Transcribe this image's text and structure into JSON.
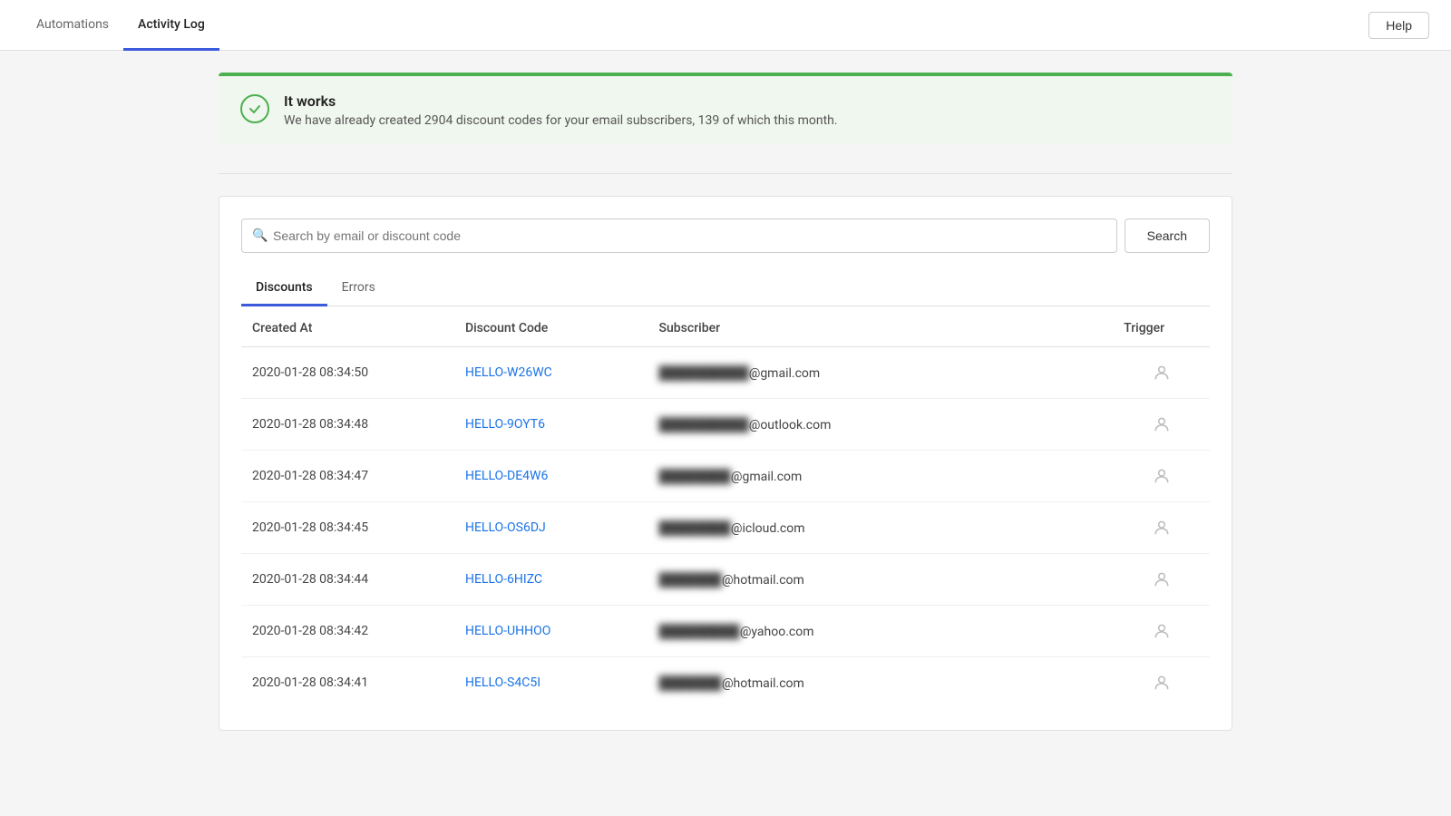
{
  "nav": {
    "tabs": [
      {
        "id": "automations",
        "label": "Automations",
        "active": false
      },
      {
        "id": "activity-log",
        "label": "Activity Log",
        "active": true
      }
    ],
    "help_label": "Help"
  },
  "banner": {
    "title": "It works",
    "description": "We have already created 2904 discount codes for your email subscribers, 139 of which this month."
  },
  "search": {
    "placeholder": "Search by email or discount code",
    "button_label": "Search"
  },
  "tabs": [
    {
      "id": "discounts",
      "label": "Discounts",
      "active": true
    },
    {
      "id": "errors",
      "label": "Errors",
      "active": false
    }
  ],
  "table": {
    "columns": [
      {
        "id": "created_at",
        "label": "Created At"
      },
      {
        "id": "discount_code",
        "label": "Discount Code"
      },
      {
        "id": "subscriber",
        "label": "Subscriber"
      },
      {
        "id": "trigger",
        "label": "Trigger"
      }
    ],
    "rows": [
      {
        "created_at": "2020-01-28 08:34:50",
        "discount_code": "HELLO-W26WC",
        "subscriber": "██████████@gmail.com",
        "trigger": "person"
      },
      {
        "created_at": "2020-01-28 08:34:48",
        "discount_code": "HELLO-9OYT6",
        "subscriber": "██████████@outlook.com",
        "trigger": "person"
      },
      {
        "created_at": "2020-01-28 08:34:47",
        "discount_code": "HELLO-DE4W6",
        "subscriber": "████████@gmail.com",
        "trigger": "person"
      },
      {
        "created_at": "2020-01-28 08:34:45",
        "discount_code": "HELLO-OS6DJ",
        "subscriber": "████████@icloud.com",
        "trigger": "person"
      },
      {
        "created_at": "2020-01-28 08:34:44",
        "discount_code": "HELLO-6HIZC",
        "subscriber": "███████@hotmail.com",
        "trigger": "person"
      },
      {
        "created_at": "2020-01-28 08:34:42",
        "discount_code": "HELLO-UHHOO",
        "subscriber": "█████████@yahoo.com",
        "trigger": "person"
      },
      {
        "created_at": "2020-01-28 08:34:41",
        "discount_code": "HELLO-S4C5I",
        "subscriber": "███████@hotmail.com",
        "trigger": "person"
      }
    ]
  }
}
